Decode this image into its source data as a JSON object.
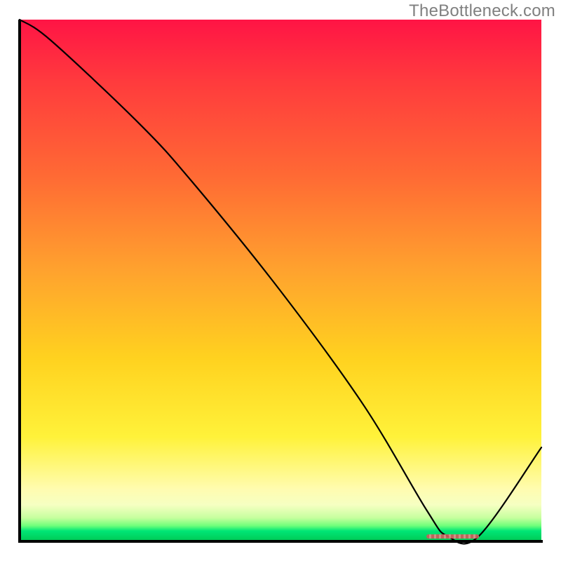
{
  "watermark": "TheBottleneck.com",
  "chart_data": {
    "type": "line",
    "title": "",
    "xlabel": "",
    "ylabel": "",
    "xlim": [
      0,
      100
    ],
    "ylim": [
      0,
      100
    ],
    "background_gradient": {
      "orientation": "vertical",
      "stops": [
        {
          "pos": 0,
          "color": "#ff1445"
        },
        {
          "pos": 50,
          "color": "#ffb02a"
        },
        {
          "pos": 80,
          "color": "#fff23a"
        },
        {
          "pos": 100,
          "color": "#00c853"
        }
      ]
    },
    "series": [
      {
        "name": "bottleneck-curve",
        "x": [
          0,
          6,
          23,
          33,
          50,
          66,
          78,
          82,
          88,
          100
        ],
        "y": [
          100,
          96,
          80,
          69,
          48,
          26,
          6,
          1,
          1,
          18
        ]
      }
    ],
    "annotations": [
      {
        "name": "optimal-range",
        "type": "segment",
        "y": 1,
        "x_start": 78,
        "x_end": 88,
        "color": "#d05a5a"
      }
    ]
  }
}
